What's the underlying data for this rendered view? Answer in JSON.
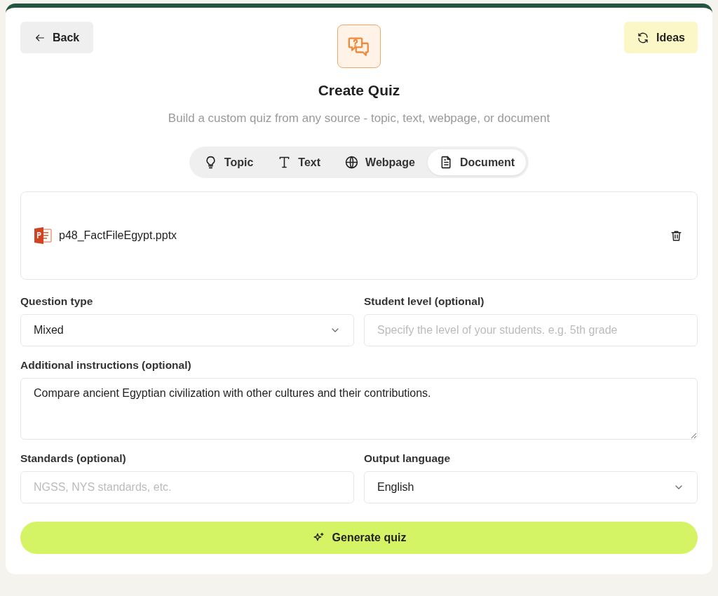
{
  "header": {
    "back_button": "Back",
    "ideas_button": "Ideas",
    "title": "Create Quiz",
    "subtitle": "Build a custom quiz from any source - topic, text, webpage, or document"
  },
  "source_tabs": [
    {
      "label": "Topic",
      "kind": "topic",
      "selected": false
    },
    {
      "label": "Text",
      "kind": "text",
      "selected": false
    },
    {
      "label": "Webpage",
      "kind": "webpage",
      "selected": false
    },
    {
      "label": "Document",
      "kind": "document",
      "selected": true
    }
  ],
  "file": {
    "name": "p48_FactFileEgypt.pptx"
  },
  "fields": [
    {
      "label": "Question type",
      "kind": "select",
      "value": "Mixed"
    },
    {
      "label": "Student level (optional)",
      "kind": "input",
      "placeholder": "Specify the level of your students. e.g. 5th grade"
    },
    {
      "label": "Additional instructions (optional)",
      "kind": "textarea",
      "value": "Compare ancient Egyptian civilization with other cultures and their contributions."
    },
    {
      "label": "Standards (optional)",
      "kind": "input",
      "placeholder": "NGSS, NYS standards, etc."
    },
    {
      "label": "Output language",
      "kind": "select",
      "value": "English"
    }
  ],
  "generate_button": "Generate quiz"
}
